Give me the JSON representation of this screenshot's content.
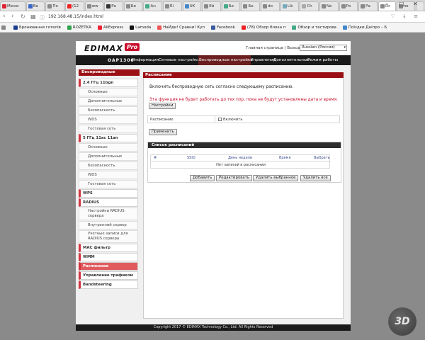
{
  "browser": {
    "tabs": [
      {
        "label": "Меню",
        "color": "#d23"
      },
      {
        "label": "Ва",
        "color": "#3a67c8"
      },
      {
        "label": "По",
        "color": "#888"
      },
      {
        "label": "(12",
        "color": "#e22"
      },
      {
        "label": "ww",
        "color": "#888"
      },
      {
        "label": "Ра",
        "color": "#333"
      },
      {
        "label": "Бе",
        "color": "#888"
      },
      {
        "label": "Ан",
        "color": "#4a8"
      },
      {
        "label": "Ei",
        "color": "#888"
      },
      {
        "label": "UK",
        "color": "#48c"
      },
      {
        "label": "Ей",
        "color": "#888"
      },
      {
        "label": "Бе",
        "color": "#4a8"
      },
      {
        "label": "Бе",
        "color": "#888"
      },
      {
        "label": "do",
        "color": "#888"
      },
      {
        "label": "Lik",
        "color": "#7ab"
      },
      {
        "label": "Ch",
        "color": "#aaa"
      },
      {
        "label": "Ne",
        "color": "#888"
      },
      {
        "label": "Ре",
        "color": "#888"
      },
      {
        "label": "Ра",
        "color": "#888"
      },
      {
        "label": "Ос",
        "color": "#888"
      },
      {
        "label": "по",
        "color": "#888"
      }
    ],
    "url": "192.168.48.15/index.html",
    "bookmarks": [
      {
        "label": "Бронювання готелів",
        "color": "#1b3d8f"
      },
      {
        "label": "ROZETKA",
        "color": "#2ea24c"
      },
      {
        "label": "AliExpress",
        "color": "#e23"
      },
      {
        "label": "Lamoda",
        "color": "#111"
      },
      {
        "label": "НаЙди! Сравни! Куп",
        "color": "#e55"
      },
      {
        "label": "Facebook",
        "color": "#3b5998"
      },
      {
        "label": "(78) Обзор блока п",
        "color": "#e22"
      },
      {
        "label": "Обзор и тестирова",
        "color": "#4a8"
      },
      {
        "label": "Поїздки Дніпро – Б",
        "color": "#48c"
      }
    ]
  },
  "header": {
    "brand": "EDIMAX",
    "brand_badge": "Pro",
    "home_link": "Главная страница",
    "separator": "|",
    "logout_link": "Выход",
    "language": "Russian (Россия)"
  },
  "menu": {
    "model": "OAP1300",
    "items": [
      {
        "label": "Информация",
        "active": false
      },
      {
        "label": "Сетевые настройки",
        "active": false
      },
      {
        "label": "Беспроводные настройки",
        "active": true
      },
      {
        "label": "Управление",
        "active": false
      },
      {
        "label": "Дополнительные",
        "active": false
      },
      {
        "label": "Режим работы",
        "active": false
      }
    ]
  },
  "sidebar": {
    "header": "Беспроводные",
    "items": [
      {
        "label": "2.4 ГГц 11bgn",
        "type": "group"
      },
      {
        "label": "Основные",
        "type": "sub"
      },
      {
        "label": "Дополнительные",
        "type": "sub"
      },
      {
        "label": "Безопасность",
        "type": "sub"
      },
      {
        "label": "WDS",
        "type": "sub"
      },
      {
        "label": "Гостевая сеть",
        "type": "sub"
      },
      {
        "label": "5 ГГц 11ac 11an",
        "type": "group"
      },
      {
        "label": "Основные",
        "type": "sub"
      },
      {
        "label": "Дополнительные",
        "type": "sub"
      },
      {
        "label": "Безопасность",
        "type": "sub"
      },
      {
        "label": "WDS",
        "type": "sub"
      },
      {
        "label": "Гостевая сеть",
        "type": "sub"
      },
      {
        "label": "WPS",
        "type": "group"
      },
      {
        "label": "RADIUS",
        "type": "group"
      },
      {
        "label": "Настройки RADIUS сервера",
        "type": "sub-tall"
      },
      {
        "label": "Внутренний сервер",
        "type": "sub"
      },
      {
        "label": "Учетные записи для RADIUS сервера",
        "type": "sub-tall"
      },
      {
        "label": "MAC фильтр",
        "type": "group"
      },
      {
        "label": "WMM",
        "type": "group"
      },
      {
        "label": "Расписание",
        "type": "active"
      },
      {
        "label": "Управление трафиком",
        "type": "group"
      },
      {
        "label": "Bandsteering",
        "type": "group"
      }
    ]
  },
  "panel": {
    "title": "Расписание",
    "intro": "Включить беспроводную сеть согласно следующему расписанию.",
    "warning": "Эта функция не будет работать до тех пор, пока не будут установлены дата и время.",
    "settings_button": "Настройки",
    "schedule_label": "Расписание",
    "enable_label": "Включить",
    "apply_button": "Применить",
    "list_title": "Список расписаний",
    "columns": [
      "#",
      "SSID",
      "День недели",
      "Время",
      "Выбрать"
    ],
    "empty_text": "Нет записей в расписании",
    "actions": {
      "add": "Добавить",
      "edit": "Редактировать",
      "delete_selected": "Удалить выбранное",
      "delete_all": "Удалить все"
    }
  },
  "footer": {
    "copyright": "Copyright 2017 © EDIMAX Technology Co., Ltd. All Rights Reserved"
  },
  "colors": {
    "accent_red": "#9b1015",
    "menu_bg": "#1a1a1a",
    "active_sidebar": "#e05a5e"
  }
}
